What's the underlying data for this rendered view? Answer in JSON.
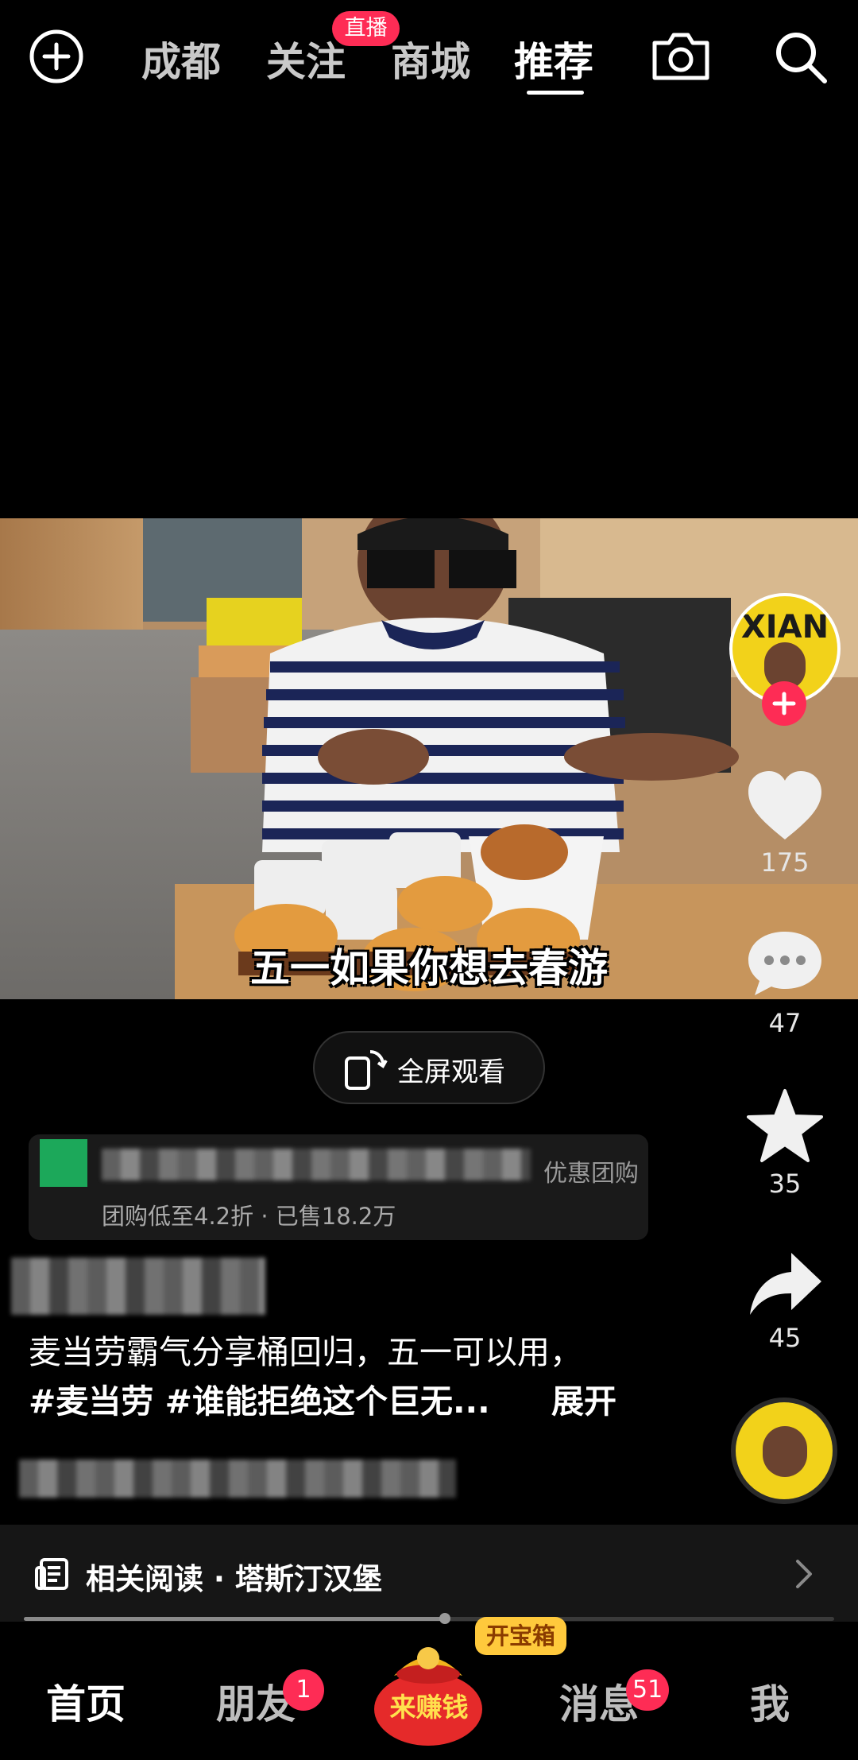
{
  "top_tabs": [
    {
      "label": "成都"
    },
    {
      "label": "关注"
    },
    {
      "label": "商城"
    },
    {
      "label": "推荐"
    }
  ],
  "live_badge": "直播",
  "video_caption": "五一如果你想去春游",
  "rail": {
    "like_count": "175",
    "comment_count": "47",
    "favorite_count": "35",
    "share_count": "45",
    "avatar_text": "XIAN"
  },
  "fullscreen_label": "全屏观看",
  "poi": {
    "tag": "优惠团购",
    "subtitle": "团购低至4.2折 · 已售18.2万"
  },
  "description": {
    "line1": "麦当劳霸气分享桶回归，五一可以用，",
    "tags": "#麦当劳 #谁能拒绝这个巨无...",
    "expand": "展开"
  },
  "related": {
    "text": "相关阅读 · 塔斯汀汉堡"
  },
  "progress": 0.52,
  "bottom_nav": {
    "home": "首页",
    "friends": "朋友",
    "friends_badge": "1",
    "earn": "来赚钱",
    "treasure": "开宝箱",
    "messages": "消息",
    "messages_badge": "51",
    "me": "我"
  },
  "colors": {
    "accent": "#fe2c55",
    "background": "#000000",
    "treasure": "#ffc93c"
  }
}
